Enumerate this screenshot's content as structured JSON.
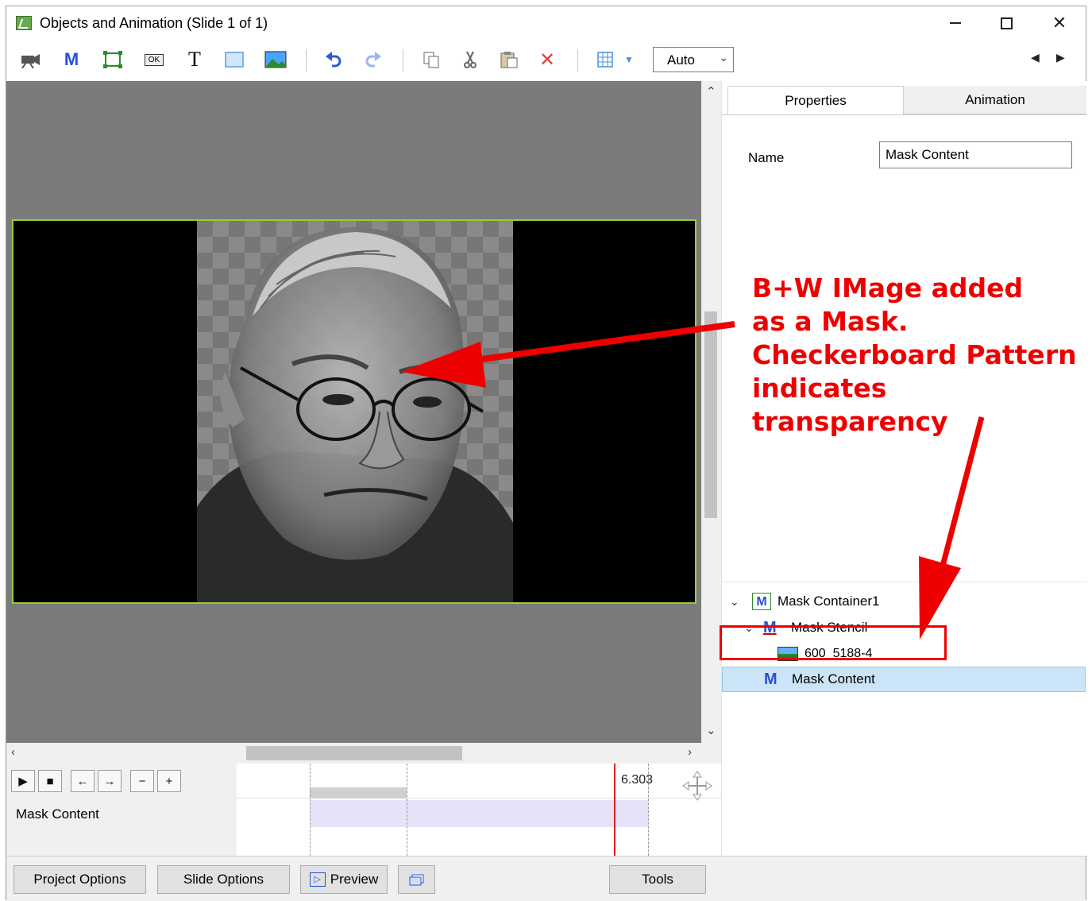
{
  "window": {
    "title": "Objects and Animation (Slide 1 of 1)"
  },
  "toolbar": {
    "icons": [
      "camera-icon",
      "mask-icon",
      "frame-icon",
      "button-icon",
      "text-icon",
      "rectangle-icon",
      "image-icon",
      "undo-icon",
      "redo-icon",
      "copy-icon",
      "cut-icon",
      "paste-icon",
      "delete-icon",
      "grid-icon"
    ],
    "m_label": "M",
    "t_label": "T",
    "ok_label": "OK",
    "zoom_value": "Auto"
  },
  "tabs": {
    "properties": "Properties",
    "animation": "Animation"
  },
  "properties": {
    "name_label": "Name",
    "name_value": "Mask Content"
  },
  "tree": {
    "items": [
      {
        "label": "Mask Container1",
        "icon_letter": "M"
      },
      {
        "label": "Mask Stencil",
        "icon_letter": "M"
      },
      {
        "label": "600_5188-4"
      },
      {
        "label": "Mask Content",
        "icon_letter": "M"
      }
    ]
  },
  "timeline": {
    "row_label": "Mask Content",
    "time_value": "6.303"
  },
  "bottom": {
    "project_options": "Project Options",
    "slide_options": "Slide Options",
    "preview": "Preview",
    "tools": "Tools"
  },
  "annotation": {
    "text": "B+W IMage added\nas a Mask.\nCheckerboard Pattern\nindicates transparency",
    "color": "#e00000"
  }
}
